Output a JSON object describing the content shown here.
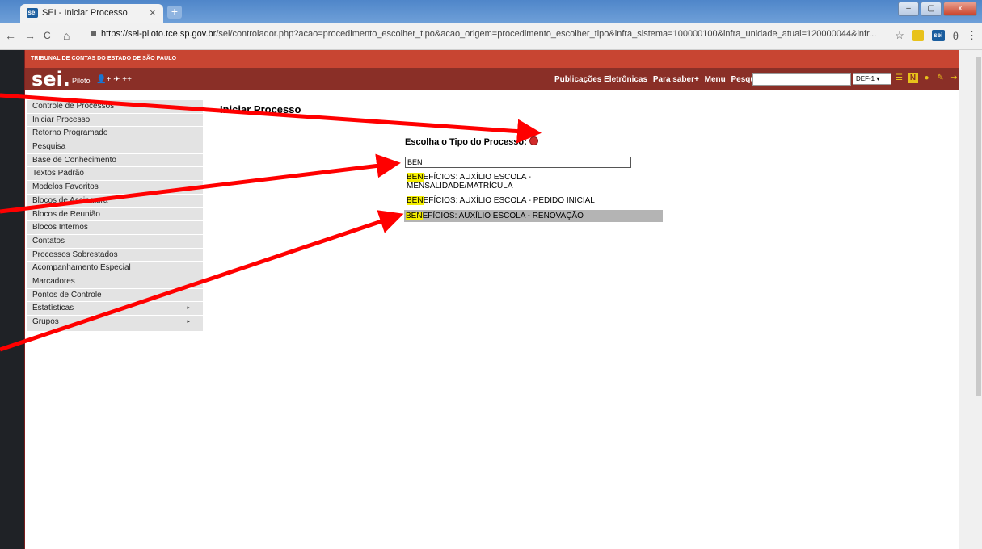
{
  "tab": {
    "favicon": "sei",
    "title": "SEI - Iniciar Processo",
    "close": "×",
    "new": "+"
  },
  "window_controls": [
    "–",
    "▢",
    "x"
  ],
  "toolbar": {
    "back": "←",
    "forward": "→",
    "reload": "C",
    "home": "⌂",
    "url_host": "https://sei-piloto.tce.sp.gov.br",
    "url_path": "/sei/controlador.php?acao=procedimento_escolher_tipo&acao_origem=procedimento_escolher_tipo&infra_sistema=100000100&infra_unidade_atual=120000044&infr...",
    "star": "☆",
    "account": "θ",
    "more": "⋮",
    "ext_label": "sei"
  },
  "header": {
    "org": "TRIBUNAL DE CONTAS DO ESTADO DE SÃO PAULO",
    "logo": "sei.",
    "env": "Piloto",
    "env_icons": "👤+ ✈ ++",
    "nav": [
      "Publicações Eletrônicas",
      "Para saber+",
      "Menu",
      "Pesquisa"
    ],
    "unit": "DEF-1 ▾"
  },
  "menu": [
    {
      "label": "Controle de Processos"
    },
    {
      "label": "Iniciar Processo"
    },
    {
      "label": "Retorno Programado"
    },
    {
      "label": "Pesquisa"
    },
    {
      "label": "Base de Conhecimento"
    },
    {
      "label": "Textos Padrão"
    },
    {
      "label": "Modelos Favoritos"
    },
    {
      "label": "Blocos de Assinatura"
    },
    {
      "label": "Blocos de Reunião"
    },
    {
      "label": "Blocos Internos"
    },
    {
      "label": "Contatos"
    },
    {
      "label": "Processos Sobrestados"
    },
    {
      "label": "Acompanhamento Especial"
    },
    {
      "label": "Marcadores"
    },
    {
      "label": "Pontos de Controle"
    },
    {
      "label": "Estatísticas",
      "arrow": "▸"
    },
    {
      "label": "Grupos",
      "arrow": "▸"
    }
  ],
  "main": {
    "title": "Iniciar Processo",
    "choose_label": "Escolha o Tipo do Processo:",
    "filter_value": "BEN",
    "options": [
      {
        "hl": "BEN",
        "line1": "EFÍCIOS: AUXÍLIO ESCOLA -",
        "line2": "MENSALIDADE/MATRÍCULA"
      },
      {
        "hl": "BEN",
        "line1": "EFÍCIOS: AUXÍLIO ESCOLA - PEDIDO INICIAL"
      },
      {
        "hl": "BEN",
        "line1": "EFÍCIOS: AUXÍLIO ESCOLA - RENOVAÇÃO",
        "selected": true
      }
    ]
  },
  "colors": {
    "header_top": "#c84532",
    "header_bar": "#8a2f27",
    "highlight": "#f5ef00",
    "arrow": "#ff0000"
  }
}
